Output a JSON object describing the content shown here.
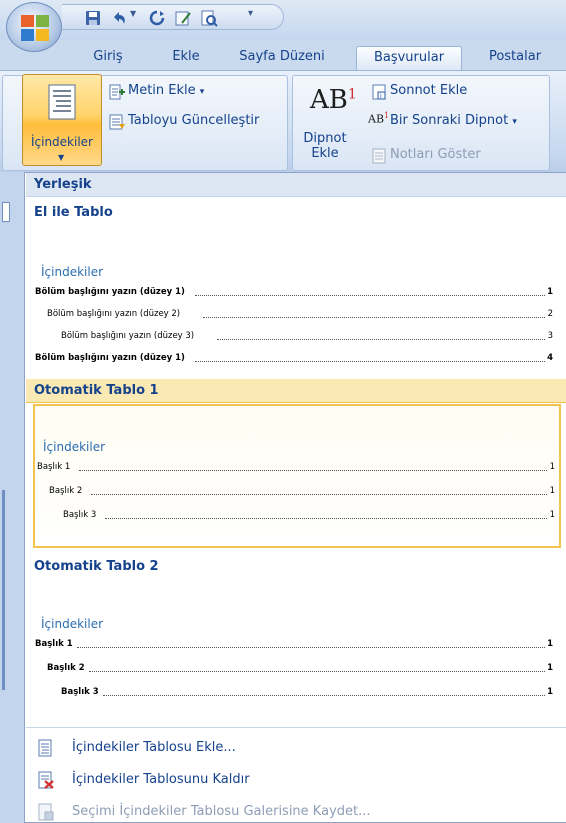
{
  "tabs": [
    {
      "label": "Giriş"
    },
    {
      "label": "Ekle"
    },
    {
      "label": "Sayfa Düzeni"
    },
    {
      "label": "Başvurular"
    },
    {
      "label": "Postalar"
    }
  ],
  "active_tab": "Başvurular",
  "ribbon": {
    "toc_button": "İçindekiler",
    "add_text": "Metin Ekle",
    "update_table": "Tabloyu Güncelleştir",
    "insert_footnote_line1": "Dipnot",
    "insert_footnote_line2": "Ekle",
    "insert_endnote": "Sonnot Ekle",
    "next_footnote": "Bir Sonraki Dipnot",
    "show_notes": "Notları Göster",
    "ab_glyph": "AB",
    "ab_sup": "1"
  },
  "dropdown": {
    "builtin_header": "Yerleşik",
    "manual": {
      "header": "El ile Tablo",
      "title": "İçindekiler",
      "lines": [
        {
          "text": "Bölüm başlığını yazın (düzey 1)",
          "page": "1",
          "level": 1
        },
        {
          "text": "Bölüm başlığını yazın (düzey 2)",
          "page": "2",
          "level": 2
        },
        {
          "text": "Bölüm başlığını yazın (düzey 3)",
          "page": "3",
          "level": 3
        },
        {
          "text": "Bölüm başlığını yazın (düzey 1)",
          "page": "4",
          "level": 1
        }
      ]
    },
    "auto1": {
      "header": "Otomatik Tablo 1",
      "title": "İçindekiler",
      "lines": [
        {
          "text": "Başlık 1",
          "page": "1",
          "level": 1
        },
        {
          "text": "Başlık 2",
          "page": "1",
          "level": 2
        },
        {
          "text": "Başlık 3",
          "page": "1",
          "level": 3
        }
      ]
    },
    "auto2": {
      "header": "Otomatik Tablo 2",
      "title": "İçindekiler",
      "lines": [
        {
          "text": "Başlık 1",
          "page": "1",
          "level": 1
        },
        {
          "text": "Başlık 2",
          "page": "1",
          "level": 2
        },
        {
          "text": "Başlık 3",
          "page": "1",
          "level": 3
        }
      ]
    },
    "commands": {
      "insert_toc": "İçindekiler Tablosu Ekle...",
      "remove_toc": "İçindekiler Tablosunu Kaldır",
      "save_selection": "Seçimi İçindekiler Tablosu Galerisine Kaydet..."
    }
  },
  "colors": {
    "accent": "#15428b",
    "selection_border": "#f2c44d",
    "toc_title": "#2b6cb0"
  }
}
